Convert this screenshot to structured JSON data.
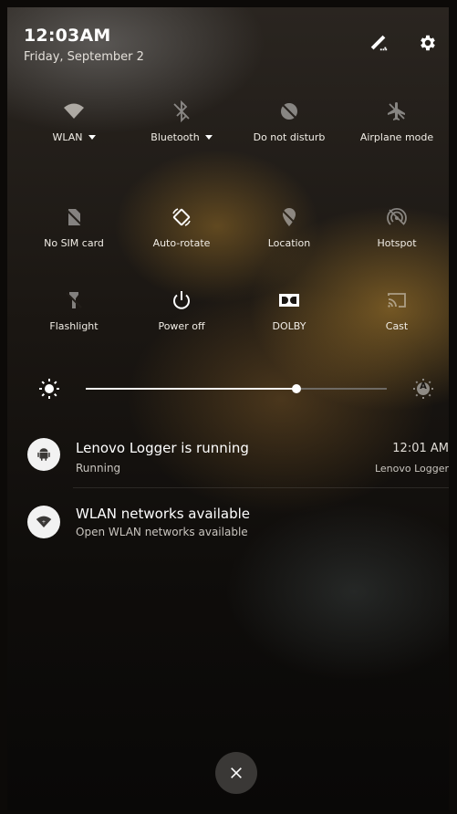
{
  "status": {
    "time": "12:03",
    "ampm": "AM",
    "date": "Friday, September 2"
  },
  "top_actions": {
    "edit_icon": "edit-qs-icon",
    "settings_icon": "gear-icon"
  },
  "quick_settings": {
    "row1": [
      {
        "label": "WLAN",
        "icon": "wifi-icon",
        "has_dropdown": true
      },
      {
        "label": "Bluetooth",
        "icon": "bluetooth-icon",
        "has_dropdown": true
      },
      {
        "label": "Do not disturb",
        "icon": "do-not-disturb-icon"
      },
      {
        "label": "Airplane mode",
        "icon": "airplane-icon"
      }
    ],
    "row2": [
      {
        "label": "No SIM card",
        "icon": "sim-card-icon"
      },
      {
        "label": "Auto-rotate",
        "icon": "auto-rotate-icon"
      },
      {
        "label": "Location",
        "icon": "location-icon"
      },
      {
        "label": "Hotspot",
        "icon": "hotspot-icon"
      }
    ],
    "row3": [
      {
        "label": "Flashlight",
        "icon": "flashlight-icon"
      },
      {
        "label": "Power off",
        "icon": "power-icon"
      },
      {
        "label": "DOLBY",
        "icon": "dolby-icon"
      },
      {
        "label": "Cast",
        "icon": "cast-icon"
      }
    ]
  },
  "brightness": {
    "level_percent": 70,
    "auto_icon_letter": "A"
  },
  "notifications": [
    {
      "title": "Lenovo Logger is running",
      "subtitle": "Running",
      "time": "12:01 AM",
      "app": "Lenovo Logger",
      "icon": "android-icon"
    },
    {
      "title": "WLAN networks available",
      "subtitle": "Open WLAN networks available",
      "icon": "wifi-notification-icon"
    }
  ],
  "dismiss_all": {
    "icon": "close-icon"
  },
  "colors": {
    "text": "#ffffff",
    "secondary_text": "#c9c5bf",
    "slider_active": "#f4f2ef",
    "close_button": "#3a3836"
  }
}
